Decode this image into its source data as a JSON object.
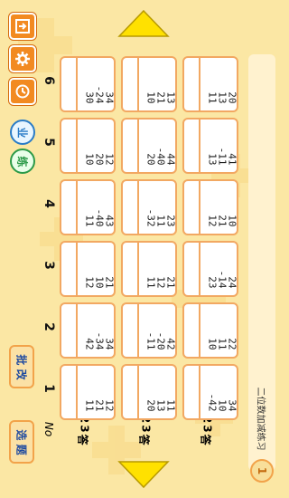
{
  "colors": {
    "background": "#fbe7a4",
    "accent": "#f28a21",
    "card_border": "#f2a862",
    "arrow": "#ffe100",
    "badge_blue": "#2a7cc7",
    "badge_green": "#2c9a48"
  },
  "header_label": "No",
  "row_labels": [
    [
      "1",
      "2",
      "3",
      "答"
    ],
    [
      "1",
      "2",
      "3",
      "答"
    ],
    [
      "1",
      "2",
      "3",
      "答"
    ]
  ],
  "columns": [
    {
      "number": "1",
      "problems": [
        [
          "12",
          "21",
          "11"
        ],
        [
          "11",
          "13",
          "20"
        ],
        [
          "34",
          "10",
          "-42"
        ]
      ]
    },
    {
      "number": "2",
      "problems": [
        [
          "34",
          "-34",
          "42"
        ],
        [
          "42",
          "-20",
          "-11"
        ],
        [
          "22",
          "11",
          "10"
        ]
      ]
    },
    {
      "number": "3",
      "problems": [
        [
          "21",
          "10",
          "12"
        ],
        [
          "21",
          "12",
          "11"
        ],
        [
          "24",
          "-14",
          "23"
        ]
      ]
    },
    {
      "number": "4",
      "problems": [
        [
          "43",
          "-40",
          "11"
        ],
        [
          "23",
          "11",
          "-32"
        ],
        [
          "10",
          "21",
          "12"
        ]
      ]
    },
    {
      "number": "5",
      "problems": [
        [
          "12",
          "20",
          "10"
        ],
        [
          "44",
          "-40",
          "20"
        ],
        [
          "41",
          "-11",
          "13"
        ]
      ]
    },
    {
      "number": "6",
      "problems": [
        [
          "34",
          "-24",
          "30"
        ],
        [
          "13",
          "21",
          "10"
        ],
        [
          "20",
          "13",
          "11"
        ]
      ]
    }
  ],
  "buttons": {
    "select": "选 题",
    "grade": "批 改"
  },
  "badges": {
    "blue": "业",
    "green": "练"
  },
  "footer": {
    "title": "二位数加减练习",
    "page": "1"
  },
  "icons": {
    "exit": "exit-icon",
    "settings": "gear-icon",
    "timer": "clock-icon"
  }
}
